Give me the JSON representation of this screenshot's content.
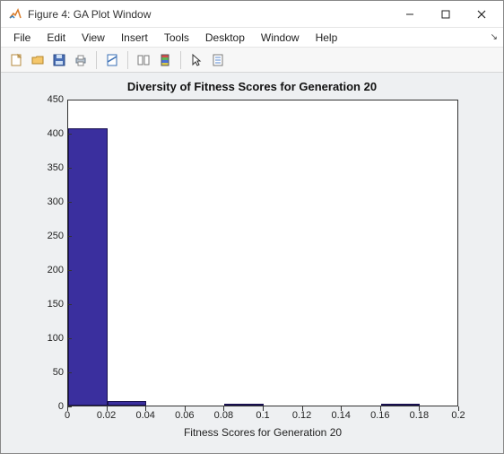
{
  "window": {
    "title": "Figure 4: GA Plot Window"
  },
  "menus": [
    "File",
    "Edit",
    "View",
    "Insert",
    "Tools",
    "Desktop",
    "Window",
    "Help"
  ],
  "toolbar_icons": [
    "new-figure-icon",
    "open-icon",
    "save-icon",
    "print-icon",
    "sep",
    "link-icon",
    "sep",
    "layout-icon",
    "colorbar-icon",
    "sep",
    "pointer-icon",
    "insert-icon"
  ],
  "chart_data": {
    "type": "bar",
    "title": "Diversity of Fitness Scores for Generation 20",
    "xlabel": "Fitness Scores for Generation 20",
    "ylabel": "",
    "xlim": [
      0,
      0.2
    ],
    "ylim": [
      0,
      450
    ],
    "xticks": [
      0,
      0.02,
      0.04,
      0.06,
      0.08,
      0.1,
      0.12,
      0.14,
      0.16,
      0.18,
      0.2
    ],
    "yticks": [
      0,
      50,
      100,
      150,
      200,
      250,
      300,
      350,
      400,
      450
    ],
    "bins": [
      {
        "x0": 0.0,
        "x1": 0.02,
        "count": 406
      },
      {
        "x0": 0.02,
        "x1": 0.04,
        "count": 6
      },
      {
        "x0": 0.04,
        "x1": 0.06,
        "count": 0
      },
      {
        "x0": 0.06,
        "x1": 0.08,
        "count": 0
      },
      {
        "x0": 0.08,
        "x1": 0.1,
        "count": 1
      },
      {
        "x0": 0.1,
        "x1": 0.12,
        "count": 0
      },
      {
        "x0": 0.12,
        "x1": 0.14,
        "count": 0
      },
      {
        "x0": 0.14,
        "x1": 0.16,
        "count": 0
      },
      {
        "x0": 0.16,
        "x1": 0.18,
        "count": 1
      },
      {
        "x0": 0.18,
        "x1": 0.2,
        "count": 0
      }
    ]
  }
}
